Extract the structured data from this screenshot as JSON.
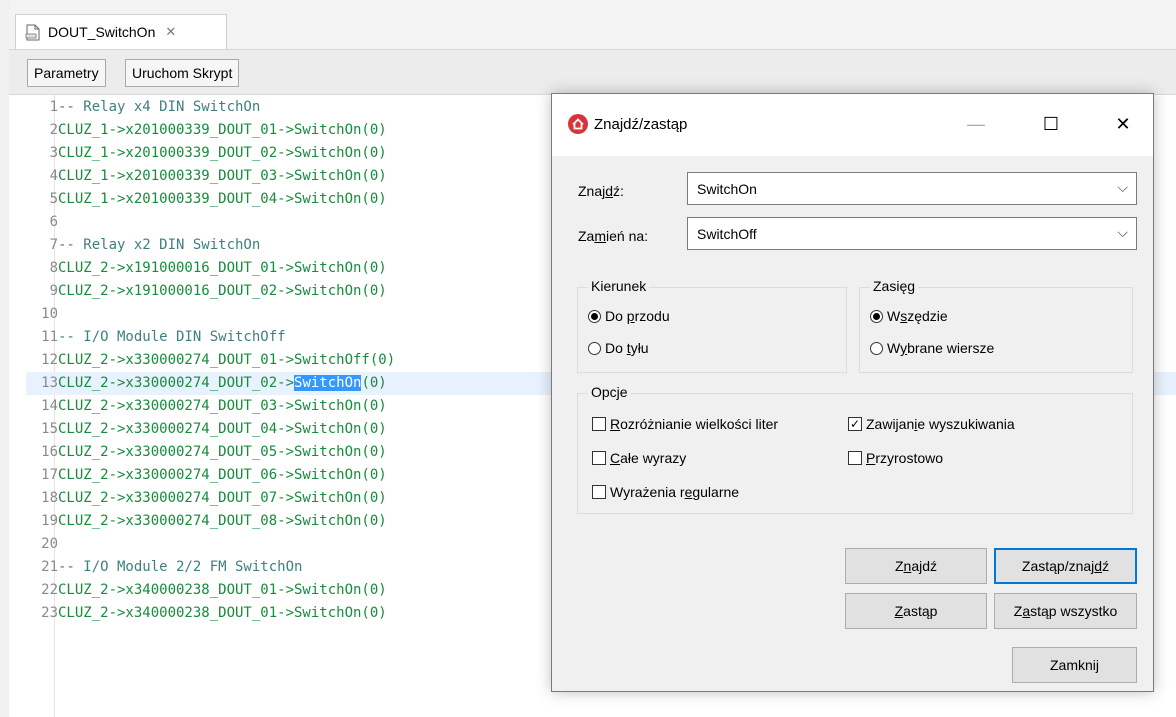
{
  "editor_tab": {
    "label": "DOUT_SwitchOn"
  },
  "toolbar": {
    "parametry": "Parametry",
    "uruchom": "Uruchom Skrypt"
  },
  "code_lines": [
    {
      "n": "1",
      "text": "-- Relay x4 DIN SwitchOn",
      "kind": "comment"
    },
    {
      "n": "2",
      "text": "CLUZ_1->x201000339_DOUT_01->SwitchOn(0)",
      "kind": "code"
    },
    {
      "n": "3",
      "text": "CLUZ_1->x201000339_DOUT_02->SwitchOn(0)",
      "kind": "code"
    },
    {
      "n": "4",
      "text": "CLUZ_1->x201000339_DOUT_03->SwitchOn(0)",
      "kind": "code"
    },
    {
      "n": "5",
      "text": "CLUZ_1->x201000339_DOUT_04->SwitchOn(0)",
      "kind": "code"
    },
    {
      "n": "6",
      "text": "",
      "kind": "code"
    },
    {
      "n": "7",
      "text": "-- Relay x2 DIN SwitchOn",
      "kind": "comment"
    },
    {
      "n": "8",
      "text": "CLUZ_2->x191000016_DOUT_01->SwitchOn(0)",
      "kind": "code"
    },
    {
      "n": "9",
      "text": "CLUZ_2->x191000016_DOUT_02->SwitchOn(0)",
      "kind": "code"
    },
    {
      "n": "10",
      "text": "",
      "kind": "code"
    },
    {
      "n": "11",
      "text": "-- I/O Module DIN SwitchOff",
      "kind": "comment"
    },
    {
      "n": "12",
      "text": "CLUZ_2->x330000274_DOUT_01->SwitchOff(0)",
      "kind": "code"
    },
    {
      "n": "13",
      "text": "CLUZ_2->x330000274_DOUT_02->",
      "sel": "SwitchOn",
      "after": "(0)",
      "kind": "code"
    },
    {
      "n": "14",
      "text": "CLUZ_2->x330000274_DOUT_03->SwitchOn(0)",
      "kind": "code"
    },
    {
      "n": "15",
      "text": "CLUZ_2->x330000274_DOUT_04->SwitchOn(0)",
      "kind": "code"
    },
    {
      "n": "16",
      "text": "CLUZ_2->x330000274_DOUT_05->SwitchOn(0)",
      "kind": "code"
    },
    {
      "n": "17",
      "text": "CLUZ_2->x330000274_DOUT_06->SwitchOn(0)",
      "kind": "code"
    },
    {
      "n": "18",
      "text": "CLUZ_2->x330000274_DOUT_07->SwitchOn(0)",
      "kind": "code"
    },
    {
      "n": "19",
      "text": "CLUZ_2->x330000274_DOUT_08->SwitchOn(0)",
      "kind": "code"
    },
    {
      "n": "20",
      "text": "",
      "kind": "code"
    },
    {
      "n": "21",
      "text": "-- I/O Module 2/2 FM SwitchOn",
      "kind": "comment"
    },
    {
      "n": "22",
      "text": "CLUZ_2->x340000238_DOUT_01->SwitchOn(0)",
      "kind": "code"
    },
    {
      "n": "23",
      "text": "CLUZ_2->x340000238_DOUT_01->SwitchOn(0)",
      "kind": "code"
    }
  ],
  "dialog": {
    "title": "Znajdź/zastąp",
    "find_label": {
      "pre": "Znaj",
      "u": "d",
      "post": "ź:"
    },
    "find_value": "SwitchOn",
    "replace_label": {
      "pre": "Za",
      "u": "m",
      "post": "ień na:"
    },
    "replace_value": "SwitchOff",
    "direction_legend": "Kierunek",
    "forward": {
      "pre": "Do ",
      "u": "p",
      "post": "rzodu"
    },
    "backward": {
      "pre": "Do ",
      "u": "t",
      "post": "yłu"
    },
    "scope_legend": "Zasięg",
    "everywhere": {
      "pre": "W",
      "u": "s",
      "post": "zędzie"
    },
    "selected_lines": {
      "pre": "W",
      "u": "y",
      "post": "brane wiersze"
    },
    "options_legend": "Opcje",
    "case_sensitive": {
      "pre": "",
      "u": "R",
      "post": "ozróżnianie wielkości liter"
    },
    "whole_words": {
      "pre": "",
      "u": "C",
      "post": "ałe wyrazy"
    },
    "regex": {
      "pre": "Wyrażenia r",
      "u": "e",
      "post": "gularne"
    },
    "wrap_search": {
      "pre": "Zawijan",
      "u": "i",
      "post": "e wyszukiwania"
    },
    "incremental": {
      "pre": "",
      "u": "P",
      "post": "rzyrostowo"
    },
    "btn_find": {
      "pre": "Z",
      "u": "n",
      "post": "ajdź"
    },
    "btn_replace_find": {
      "pre": "Zastąp/znaj",
      "u": "d",
      "post": "ź"
    },
    "btn_replace": {
      "pre": "",
      "u": "Z",
      "post": "astąp"
    },
    "btn_replace_all": {
      "pre": "Z",
      "u": "a",
      "post": "stąp wszystko"
    },
    "btn_close": "Zamknij"
  }
}
